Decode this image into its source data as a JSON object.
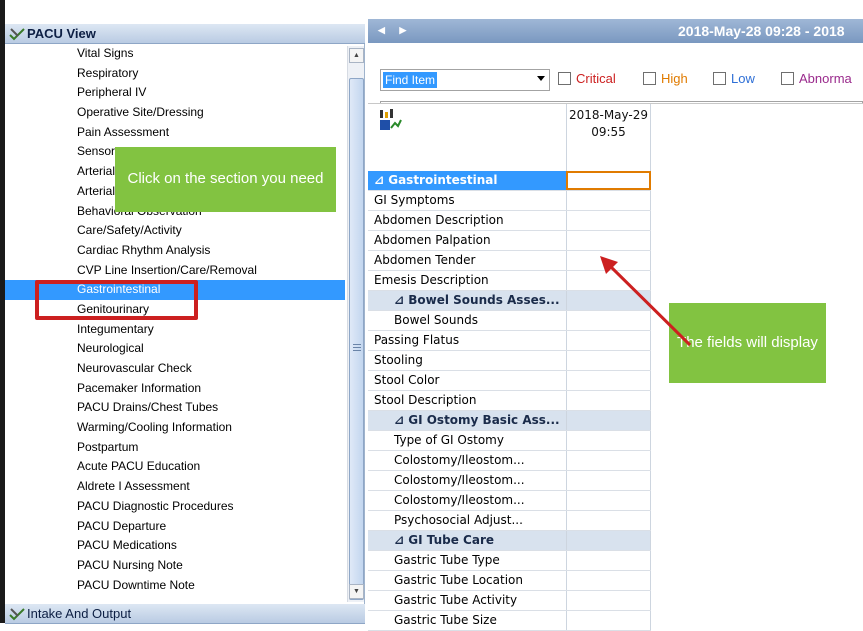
{
  "left_panel": {
    "header": "PACU View",
    "sections": [
      "Vital Signs",
      "Respiratory",
      "Peripheral IV",
      "Operative Site/Dressing",
      "Pain Assessment",
      "Sensory",
      "Arterial",
      "Arterial",
      "Behavioral Observation",
      "Care/Safety/Activity",
      "Cardiac Rhythm Analysis",
      "CVP Line Insertion/Care/Removal",
      "Gastrointestinal",
      "Genitourinary",
      "Integumentary",
      "Neurological",
      "Neurovascular Check",
      "Pacemaker Information",
      "PACU Drains/Chest Tubes",
      "Warming/Cooling Information",
      "Postpartum",
      "Acute PACU Education",
      "Aldrete I Assessment",
      "PACU Diagnostic Procedures",
      "PACU Departure",
      "PACU Medications",
      "PACU Nursing Note",
      "PACU Downtime Note"
    ],
    "selected_section": "Gastrointestinal",
    "footer": "Intake And Output"
  },
  "callouts": {
    "section": "Click on the section you need",
    "fields": "The fields will display"
  },
  "right_panel": {
    "date_range": "2018-May-28 09:28 - 2018",
    "find_item": "Find Item",
    "filters": {
      "critical": "Critical",
      "high": "High",
      "low": "Low",
      "abnormal": "Abnorma"
    },
    "column": {
      "date": "2018-May-29",
      "time": "09:55"
    },
    "rows": [
      {
        "label": "⊿ Gastrointestinal",
        "type": "main"
      },
      {
        "label": "GI Symptoms",
        "type": "field"
      },
      {
        "label": "Abdomen Description",
        "type": "field"
      },
      {
        "label": "Abdomen Palpation",
        "type": "field"
      },
      {
        "label": "Abdomen Tender",
        "type": "field"
      },
      {
        "label": "Emesis Description",
        "type": "field"
      },
      {
        "label": "⊿ Bowel Sounds Asses...",
        "type": "group"
      },
      {
        "label": "Bowel Sounds",
        "type": "subfield"
      },
      {
        "label": "Passing Flatus",
        "type": "field"
      },
      {
        "label": "Stooling",
        "type": "field"
      },
      {
        "label": "Stool Color",
        "type": "field"
      },
      {
        "label": "Stool Description",
        "type": "field"
      },
      {
        "label": "⊿ GI Ostomy Basic Ass...",
        "type": "group"
      },
      {
        "label": "Type of GI Ostomy",
        "type": "subfield"
      },
      {
        "label": "Colostomy/Ileostom...",
        "type": "subfield"
      },
      {
        "label": "Colostomy/Ileostom...",
        "type": "subfield"
      },
      {
        "label": "Colostomy/Ileostom...",
        "type": "subfield"
      },
      {
        "label": "Psychosocial Adjust...",
        "type": "subfield"
      },
      {
        "label": "⊿ GI Tube Care",
        "type": "group"
      },
      {
        "label": "Gastric Tube Type",
        "type": "subfield"
      },
      {
        "label": "Gastric Tube Location",
        "type": "subfield"
      },
      {
        "label": "Gastric Tube Activity",
        "type": "subfield"
      },
      {
        "label": "Gastric Tube Size",
        "type": "subfield"
      }
    ]
  },
  "colors": {
    "selection": "#3399ff",
    "callout": "#82c341",
    "highlight": "#cc2020"
  }
}
